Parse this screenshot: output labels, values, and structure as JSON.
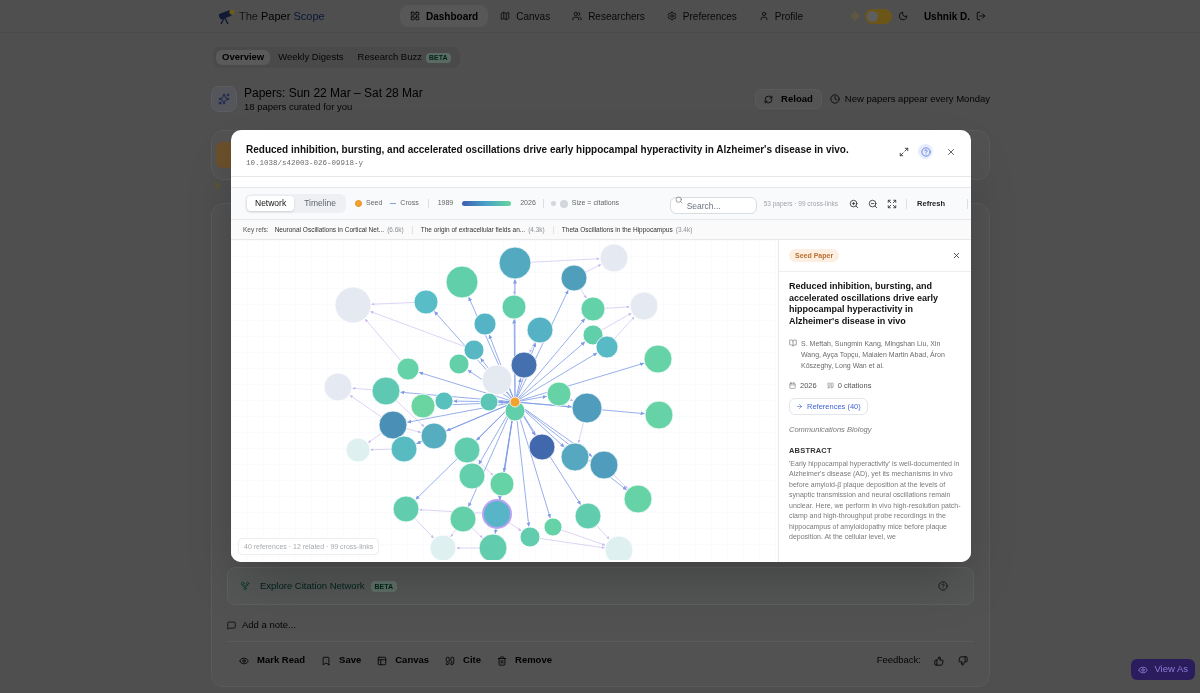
{
  "nav": {
    "brand_words": [
      "The",
      "Paper",
      "Scope"
    ],
    "items": [
      {
        "label": "Dashboard",
        "selected": true
      },
      {
        "label": "Canvas",
        "selected": false
      },
      {
        "label": "Researchers",
        "selected": false
      },
      {
        "label": "Preferences",
        "selected": false
      },
      {
        "label": "Profile",
        "selected": false
      }
    ],
    "theme_toggle": {
      "on": false
    },
    "user": "Ushnik D."
  },
  "subtabs": [
    {
      "label": "Overview",
      "selected": true
    },
    {
      "label": "Weekly Digests",
      "selected": false
    },
    {
      "label": "Research Buzz",
      "selected": false,
      "badge": "BETA"
    }
  ],
  "header": {
    "title": "Papers: Sun 22 Mar – Sat 28 Mar",
    "subtitle": "18 papers curated for you",
    "reload": "Reload",
    "note": "New papers appear every Monday"
  },
  "card": {
    "explore": {
      "label": "Explore Citation Network",
      "badge": "BETA"
    },
    "note_placeholder": "Add a note...",
    "actions": [
      "Mark Read",
      "Save",
      "Canvas",
      "Cite",
      "Remove"
    ],
    "feedback": "Feedback:"
  },
  "view_as": "View As",
  "modal": {
    "title": "Reduced inhibition, bursting, and accelerated oscillations drive early hippocampal hyperactivity in Alzheimer's disease in vivo.",
    "doi": "10.1038/s42003-026-09918-y",
    "toolbar": {
      "views": [
        {
          "label": "Network",
          "selected": true
        },
        {
          "label": "Timeline",
          "selected": false
        }
      ],
      "legend": {
        "seed": "Seed",
        "cross": "Cross",
        "year_start": "1989",
        "year_end": "2026",
        "size": "Size = citations"
      },
      "search_placeholder": "Search...",
      "stats": "53 papers · 99 cross-links",
      "refresh": "Refresh"
    },
    "key_refs": {
      "label": "Key refs:",
      "items": [
        {
          "title": "Neuronal Oscillations in Cortical Net...",
          "count": "(6.6k)"
        },
        {
          "title": "The origin of extracellular fields an...",
          "count": "(4.3k)"
        },
        {
          "title": "Theta Oscillations in the Hippocampus",
          "count": "(3.4k)"
        }
      ]
    },
    "graph": {
      "nodes": [
        {
          "kind": "related",
          "color": "#e5e9f1",
          "highlighted": false
        },
        {
          "kind": "reference",
          "color": "#62cfab",
          "highlighted": false
        },
        {
          "kind": "reference",
          "color": "#58bdc6",
          "highlighted": false
        },
        {
          "kind": "reference",
          "color": "#55b3c6",
          "highlighted": false
        },
        {
          "kind": "reference",
          "color": "#57b8c4",
          "highlighted": false
        },
        {
          "kind": "reference",
          "color": "#64d0a9",
          "highlighted": false
        },
        {
          "kind": "reference",
          "color": "#66d2a7",
          "highlighted": false
        },
        {
          "kind": "related",
          "color": "#e5e9f1",
          "highlighted": false
        },
        {
          "kind": "reference",
          "color": "#5fc8b2",
          "highlighted": false
        },
        {
          "kind": "reference",
          "color": "#58c0bd",
          "highlighted": false
        },
        {
          "kind": "reference",
          "color": "#6ad5a1",
          "highlighted": false
        },
        {
          "kind": "reference",
          "color": "#5cc5b5",
          "highlighted": false
        },
        {
          "kind": "reference",
          "color": "#4a8fb6",
          "highlighted": false
        },
        {
          "kind": "reference",
          "color": "#55adbf",
          "highlighted": false
        },
        {
          "kind": "reference",
          "color": "#58bbc1",
          "highlighted": false
        },
        {
          "kind": "related",
          "color": "#dff0f1",
          "highlighted": false
        },
        {
          "kind": "reference",
          "color": "#62cdae",
          "highlighted": false
        },
        {
          "kind": "reference",
          "color": "#63cfac",
          "highlighted": false
        },
        {
          "kind": "reference",
          "color": "#66d3a6",
          "highlighted": false
        },
        {
          "kind": "reference",
          "color": "#62cdae",
          "highlighted": false
        },
        {
          "kind": "reference",
          "color": "#64d0aa",
          "highlighted": false
        },
        {
          "kind": "reference",
          "color": "#58b5c8",
          "highlighted": true
        },
        {
          "kind": "related",
          "color": "#dff0f1",
          "highlighted": false
        },
        {
          "kind": "reference",
          "color": "#62cdae",
          "highlighted": false
        },
        {
          "kind": "reference",
          "color": "#52a9c0",
          "highlighted": false
        },
        {
          "kind": "reference",
          "color": "#4f9fbc",
          "highlighted": false
        },
        {
          "kind": "related",
          "color": "#e5e9f1",
          "highlighted": false
        },
        {
          "kind": "reference",
          "color": "#62cfab",
          "highlighted": false
        },
        {
          "kind": "reference",
          "color": "#64d2a8",
          "highlighted": false
        },
        {
          "kind": "related",
          "color": "#e5e9f1",
          "highlighted": false
        },
        {
          "kind": "reference",
          "color": "#55b2c4",
          "highlighted": false
        },
        {
          "kind": "reference",
          "color": "#62cfab",
          "highlighted": false
        },
        {
          "kind": "reference",
          "color": "#58bac4",
          "highlighted": false
        },
        {
          "kind": "reference",
          "color": "#4470b0",
          "highlighted": false
        },
        {
          "kind": "reference",
          "color": "#66d3a6",
          "highlighted": false
        },
        {
          "kind": "reference",
          "color": "#66d3a6",
          "highlighted": false
        },
        {
          "kind": "reference",
          "color": "#62cfab",
          "highlighted": false
        },
        {
          "kind": "reference",
          "color": "#4f9cbc",
          "highlighted": false
        },
        {
          "kind": "reference",
          "color": "#66d3a6",
          "highlighted": false
        },
        {
          "kind": "reference",
          "color": "#4168ac",
          "highlighted": false
        },
        {
          "kind": "reference",
          "color": "#55a8c0",
          "highlighted": false
        },
        {
          "kind": "reference",
          "color": "#4f9cbc",
          "highlighted": false
        },
        {
          "kind": "reference",
          "color": "#66d3a6",
          "highlighted": false
        },
        {
          "kind": "reference",
          "color": "#62cdae",
          "highlighted": false
        },
        {
          "kind": "reference",
          "color": "#66d3a6",
          "highlighted": false
        },
        {
          "kind": "reference",
          "color": "#62cdae",
          "highlighted": false
        },
        {
          "kind": "related",
          "color": "#dff0f1",
          "highlighted": false
        },
        {
          "kind": "related",
          "color": "#e5e9f1",
          "highlighted": false
        }
      ],
      "summary": "40 references · 12 related · 99 cross-links"
    },
    "detail": {
      "badge": "Seed Paper",
      "title": "Reduced inhibition, bursting, and accelerated oscillations drive early hippocampal hyperactivity in Alzheimer's disease in vivo",
      "authors": "S. Meftah, Sungmin Kang, Mingshan Liu, Xin Wang, Ayça Topçu, Maialen Martin Abad, Áron Kőszeghy, Long Wan et al.",
      "year": "2026",
      "citations": "0 citations",
      "references_button": "References (40)",
      "journal": "Communications Biology",
      "abstract_heading": "ABSTRACT",
      "abstract": "'Early hippocampal hyperactivity' is well-documented in Alzheimer's disease (AD), yet its mechanisms in vivo before amyloid-β plaque deposition at the levels of synaptic transmission and neural oscillations remain unclear. Here, we perform in vivo high-resolution patch-clamp and high-throughput probe recordings in the hippocampus of amyloidopathy mice before plaque deposition. At the cellular level, we"
    }
  }
}
